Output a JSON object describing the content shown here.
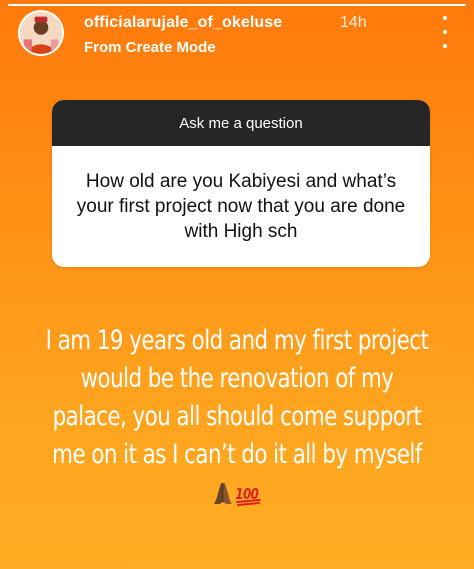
{
  "story": {
    "progress": 1.0,
    "username": "officialarujale_of_okeluse",
    "time_ago": "14h",
    "subtitle": "From Create Mode"
  },
  "question_sticker": {
    "header": "Ask me a question",
    "question": "How old are you Kabiyesi and what’s your first project now that you are done with High sch"
  },
  "answer": {
    "text": "I am 19 years old and my first project would be the renovation of my palace, you all should come support me on it as I can’t do it all by myself",
    "emojis": [
      "folded-hands-icon",
      "hundred-points-icon"
    ]
  },
  "colors": {
    "background_top": "#ff7a0c",
    "background_bottom": "#ffad24",
    "card_header": "#262626",
    "card_body": "#ffffff"
  }
}
